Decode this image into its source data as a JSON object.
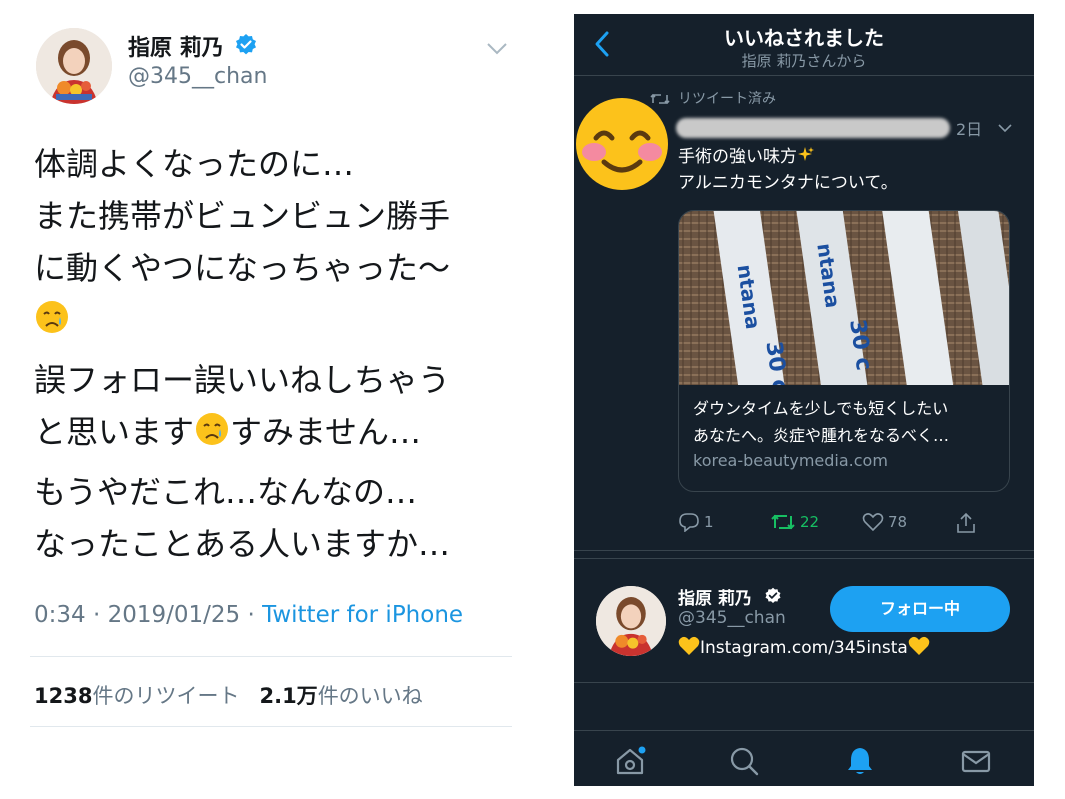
{
  "left_tweet": {
    "name": "指原 莉乃",
    "handle": "@345__chan",
    "paragraphs": [
      {
        "text": "体調よくなったのに…\nまた携帯がビュンビュン勝手\nに動くやつになっちゃった〜",
        "emoji": "crying-face"
      },
      {
        "before": "誤フォロー誤いいねしちゃう\nと思います",
        "emoji": "crying-face",
        "after": "すみません…"
      },
      {
        "text": "もうやだこれ…なんなの…\nなったことある人いますか…"
      }
    ],
    "timestamp": "0:34 · 2019/01/25 · ",
    "source": "Twitter for iPhone",
    "retweet_count": "1238",
    "retweet_label": "件のリツイート",
    "like_count": "2.1万",
    "like_label": "件のいいね"
  },
  "right_screen": {
    "header_title": "いいねされました",
    "header_sub": "指原 莉乃さんから",
    "retweeted_label": "リツイート済み",
    "time": "2日",
    "tweet_line1": "手術の強い味方",
    "tweet_line2": "アルニカモンタナについて。",
    "card_desc_line1": "ダウンタイムを少しでも短くしたい",
    "card_desc_line2": "あなたへ。炎症や腫れをなるべく…",
    "card_domain": "korea-beautymedia.com",
    "reply_count": "1",
    "retweet_count": "22",
    "like_count": "78",
    "profile_name": "指原 莉乃",
    "profile_handle": "@345__chan",
    "profile_bio": "Instagram.com/345insta",
    "follow_label": "フォロー中",
    "tabs": [
      "home-icon",
      "search-icon",
      "notifications-icon",
      "messages-icon"
    ],
    "colors": {
      "bg": "#15202b",
      "accent": "#1da1f2",
      "retweet_green": "#17bf63",
      "muted": "#8899a6"
    }
  }
}
